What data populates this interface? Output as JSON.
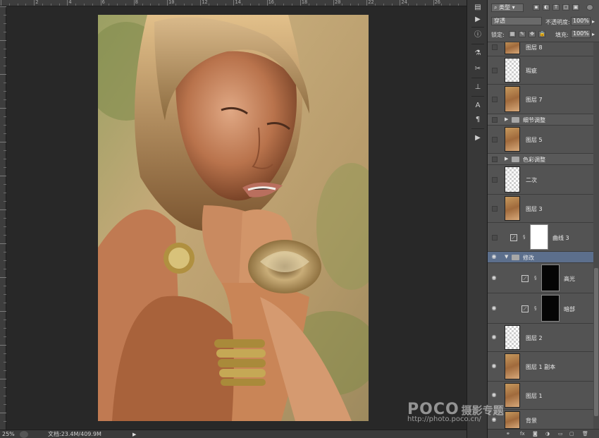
{
  "ruler": {
    "labels": [
      "",
      "2",
      "4",
      "6",
      "8",
      "10",
      "12",
      "14",
      "16",
      "18",
      "20",
      "22",
      "24",
      "26"
    ]
  },
  "status": {
    "zoom": "25%",
    "doc": "文档:23.4M/409.9M",
    "arrow": "▶"
  },
  "panel": {
    "filter_type": "类型",
    "blend_mode": "穿透",
    "opacity_label": "不透明度:",
    "opacity_value": "100%",
    "lock_label": "锁定:",
    "fill_label": "填充:",
    "fill_value": "100%",
    "footer_icons": [
      "link-icon",
      "fx",
      "mask-icon",
      "adjustment-icon",
      "folder-icon",
      "new-layer-icon",
      "trash-icon"
    ]
  },
  "layers": [
    {
      "name": "图层 8",
      "kind": "photo",
      "visible": false
    },
    {
      "name": "瑕疵",
      "kind": "transparent",
      "visible": false
    },
    {
      "name": "图层 7",
      "kind": "photo",
      "visible": false
    },
    {
      "name": "细节调整",
      "kind": "group",
      "visible": false,
      "expanded": false
    },
    {
      "name": "图层 5",
      "kind": "photo",
      "visible": false
    },
    {
      "name": "色彩调整",
      "kind": "group",
      "visible": false,
      "expanded": false
    },
    {
      "name": "二次",
      "kind": "transparent",
      "visible": false
    },
    {
      "name": "图层 3",
      "kind": "photo",
      "visible": false
    },
    {
      "name": "曲线 3",
      "kind": "adjustment",
      "visible": false
    },
    {
      "name": "修改",
      "kind": "group",
      "visible": true,
      "expanded": true,
      "selected": true
    },
    {
      "name": "高光",
      "kind": "adjustment-dark",
      "visible": true
    },
    {
      "name": "暗部",
      "kind": "adjustment-dark",
      "visible": true
    },
    {
      "name": "图层 2",
      "kind": "transparent",
      "visible": true
    },
    {
      "name": "图层 1 副本",
      "kind": "photo",
      "visible": true
    },
    {
      "name": "图层 1",
      "kind": "photo",
      "visible": true
    },
    {
      "name": "背景",
      "kind": "photo",
      "visible": true
    }
  ],
  "watermark": {
    "brand": "POCO",
    "cn": "摄影专题",
    "url": "http://photo.poco.cn/"
  },
  "colors": {
    "panel": "#535353",
    "selected": "#5c6f8c",
    "canvas_bg": "#282828"
  }
}
